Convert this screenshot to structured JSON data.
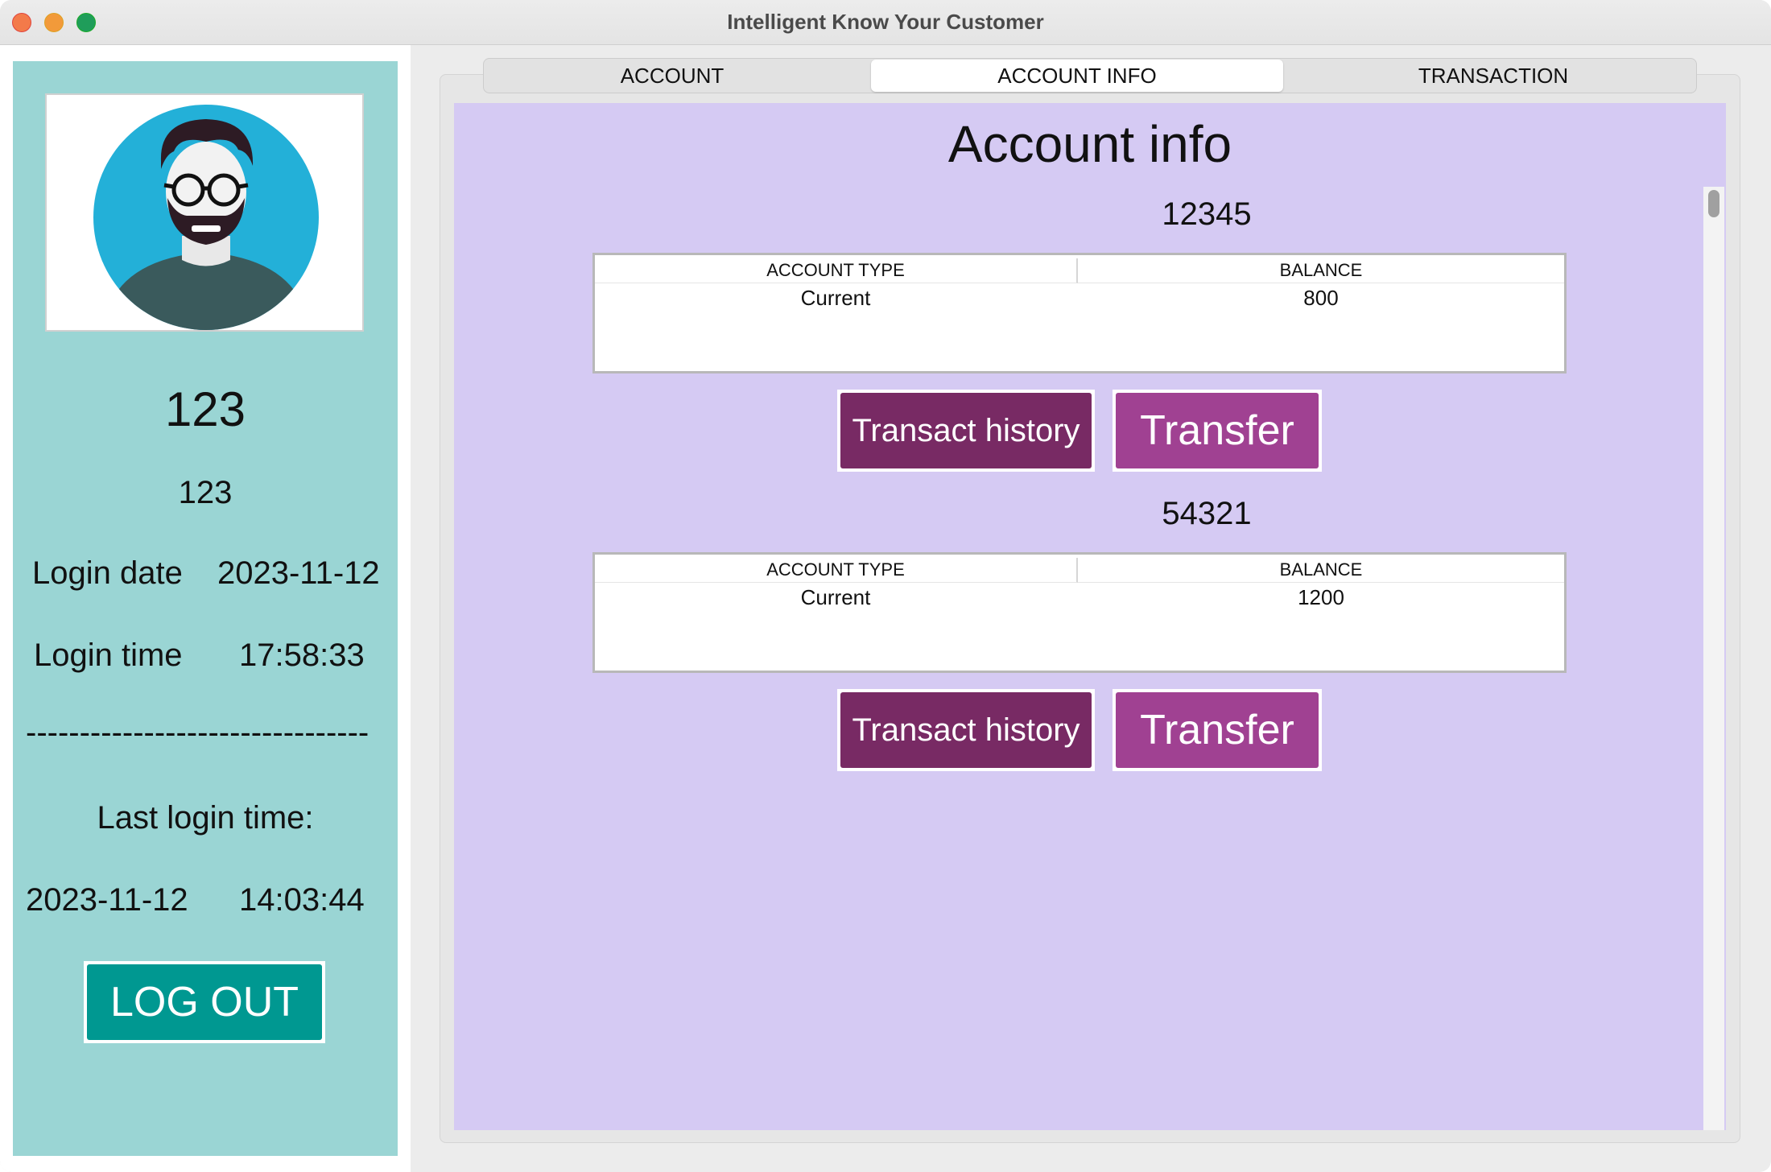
{
  "window": {
    "title": "Intelligent Know Your Customer"
  },
  "sidebar": {
    "username_large": "123",
    "username_small": "123",
    "login_date_label": "Login date",
    "login_date": "2023-11-12",
    "login_time_label": "Login time",
    "login_time": "17:58:33",
    "divider": "--------------------------------",
    "last_login_label": "Last login time:",
    "last_login_date": "2023-11-12",
    "last_login_time": "14:03:44",
    "logout_label": "LOG OUT",
    "avatar_icon": "user-avatar-icon"
  },
  "tabs": [
    {
      "label": "ACCOUNT",
      "active": false
    },
    {
      "label": "ACCOUNT INFO",
      "active": true
    },
    {
      "label": "TRANSACTION",
      "active": false
    }
  ],
  "main": {
    "title": "Account info",
    "accounts": [
      {
        "number": "12345",
        "columns": [
          "ACCOUNT TYPE",
          "BALANCE"
        ],
        "rows": [
          [
            "Current",
            "800"
          ]
        ],
        "history_label": "Transact history",
        "transfer_label": "Transfer"
      },
      {
        "number": "54321",
        "columns": [
          "ACCOUNT TYPE",
          "BALANCE"
        ],
        "rows": [
          [
            "Current",
            "1200"
          ]
        ],
        "history_label": "Transact history",
        "transfer_label": "Transfer"
      }
    ]
  },
  "colors": {
    "sidebar_bg": "#9ad5d4",
    "content_bg": "#d5caf3",
    "logout_button": "#009891",
    "history_button": "#782a64",
    "transfer_button": "#a04192"
  }
}
